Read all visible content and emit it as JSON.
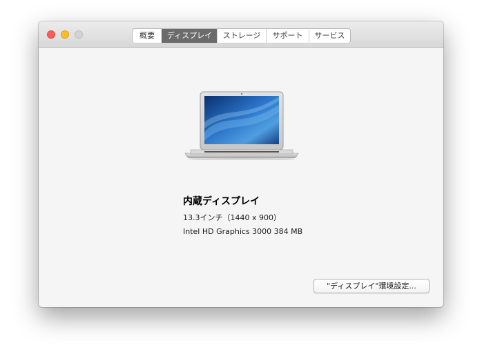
{
  "window": {
    "controls": {
      "close_icon": "close-icon",
      "minimize_icon": "minimize-icon",
      "zoom_icon": "zoom-icon"
    },
    "tabs": [
      {
        "label": "概要",
        "active": false
      },
      {
        "label": "ディスプレイ",
        "active": true
      },
      {
        "label": "ストレージ",
        "active": false
      },
      {
        "label": "サポート",
        "active": false
      },
      {
        "label": "サービス",
        "active": false
      }
    ]
  },
  "display": {
    "image_icon": "macbook-air-icon",
    "name": "内蔵ディスプレイ",
    "size": "13.3インチ（1440 x 900）",
    "graphics": "Intel HD Graphics 3000 384 MB"
  },
  "actions": {
    "preferences_button": "\"ディスプレイ\"環境設定..."
  },
  "colors": {
    "close": "#fc5d57",
    "minimize": "#fdbb2f",
    "zoom_disabled": "#d4d4d4",
    "active_tab": "#6b6b6b"
  }
}
